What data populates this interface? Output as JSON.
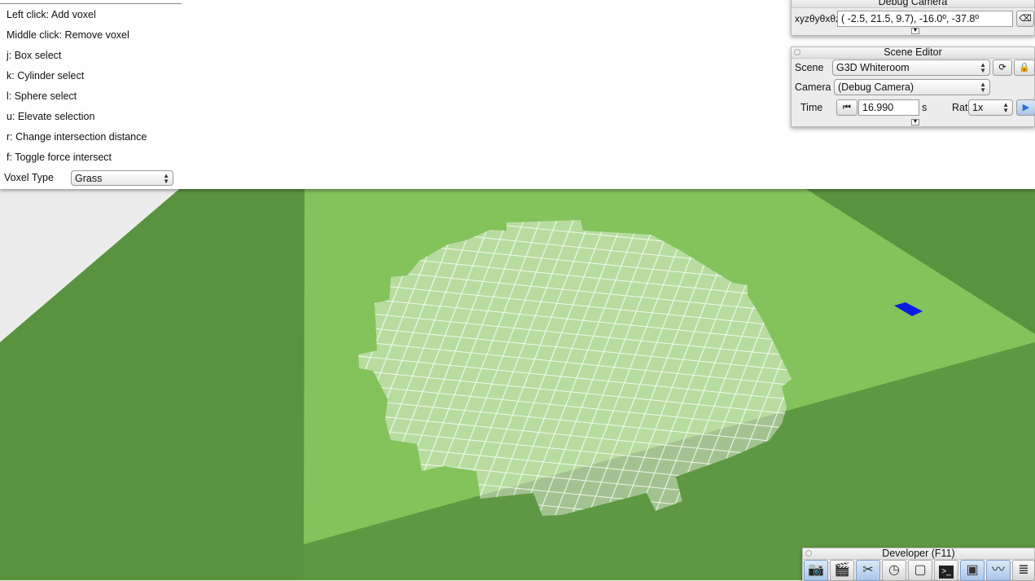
{
  "help": {
    "lines": [
      "Left click: Add voxel",
      "Middle click: Remove voxel",
      "j: Box select",
      "k: Cylinder select",
      "l: Sphere select",
      "u: Elevate selection",
      "r: Change intersection distance",
      "f: Toggle force intersect"
    ],
    "voxel_type_label": "Voxel Type",
    "voxel_type_value": "Grass"
  },
  "debug_camera": {
    "title": "Debug Camera",
    "xyz_label": "xyzθyθxθz",
    "position_value": "( -2.5,  21.5,   9.7), -16.0º, -37.8º"
  },
  "scene_editor": {
    "title": "Scene Editor",
    "scene_label": "Scene",
    "scene_value": "G3D Whiteroom",
    "camera_label": "Camera",
    "camera_value": "(Debug Camera)",
    "time_label": "Time",
    "time_value": "16.990",
    "time_unit": "s",
    "rate_label": "Rate",
    "rate_value": "1x"
  },
  "developer": {
    "title": "Developer (F11)",
    "tools": [
      "camera-icon",
      "clapperboard-icon",
      "tools-icon",
      "clock-icon",
      "new-window-icon",
      "terminal-icon",
      "scene-window-icon",
      "profiler-icon",
      "document-icon"
    ]
  },
  "colors": {
    "floor_dark": "#558f3c",
    "floor_light": "#82c05a",
    "selection": "#0a1ee0"
  }
}
